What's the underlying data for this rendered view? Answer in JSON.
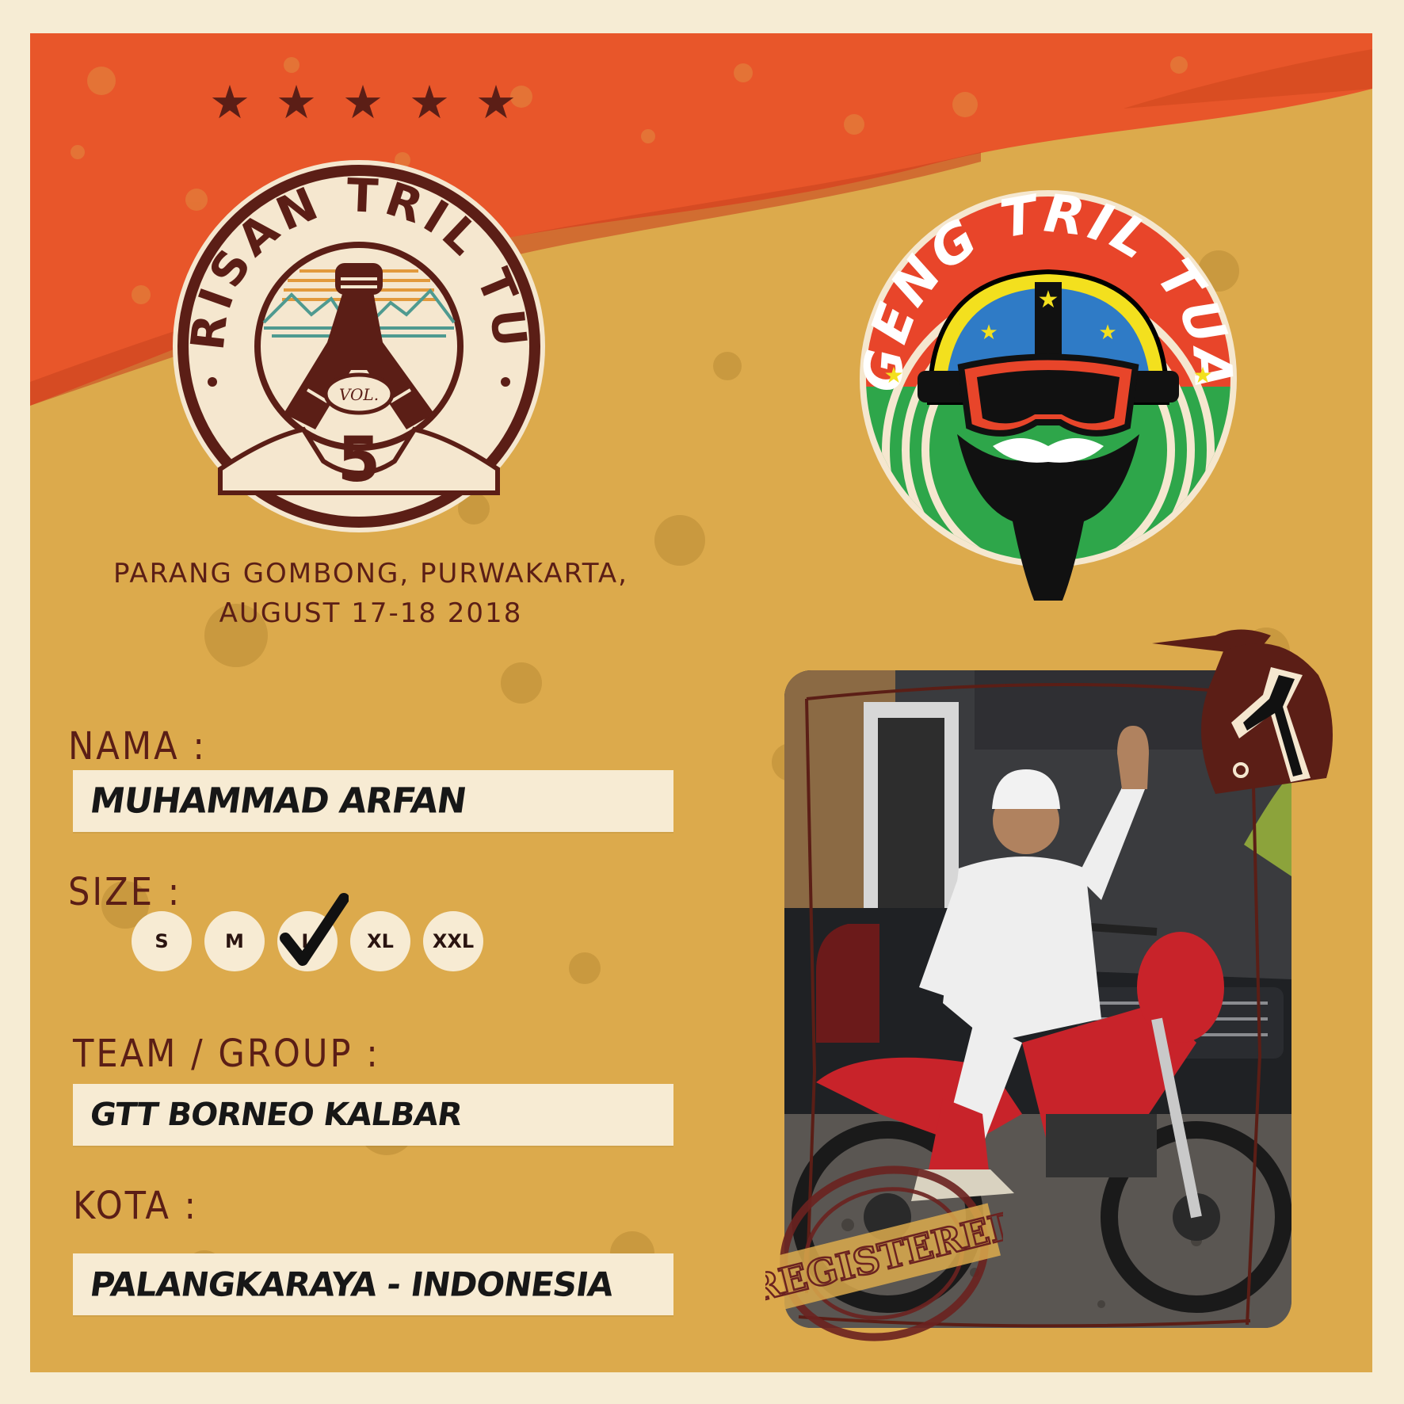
{
  "event": {
    "rating_stars": 5,
    "logo_text": "ARISAN TRIL TUA",
    "vol_label": "VOL.",
    "vol_number": "5",
    "location": "PARANG GOMBONG, PURWAKARTA,",
    "date": "AUGUST 17-18 2018"
  },
  "club": {
    "logo_text": "GENG TRIL TUA"
  },
  "form": {
    "nama": {
      "label": "NAMA :",
      "value": "MUHAMMAD ARFAN"
    },
    "size": {
      "label": "SIZE :",
      "options": [
        "S",
        "M",
        "L",
        "XL",
        "XXL"
      ],
      "selected": "L"
    },
    "team": {
      "label": "TEAM / GROUP :",
      "value": "GTT BORNEO KALBAR"
    },
    "kota": {
      "label": "KOTA :",
      "value": "PALANGKARAYA - INDONESIA"
    }
  },
  "photo": {
    "stamp_text": "REGISTERED"
  },
  "colors": {
    "background": "#dcaa4c",
    "banner": "#e8562a",
    "accent_dark": "#5b1e16",
    "panel": "#f7ebd3"
  }
}
